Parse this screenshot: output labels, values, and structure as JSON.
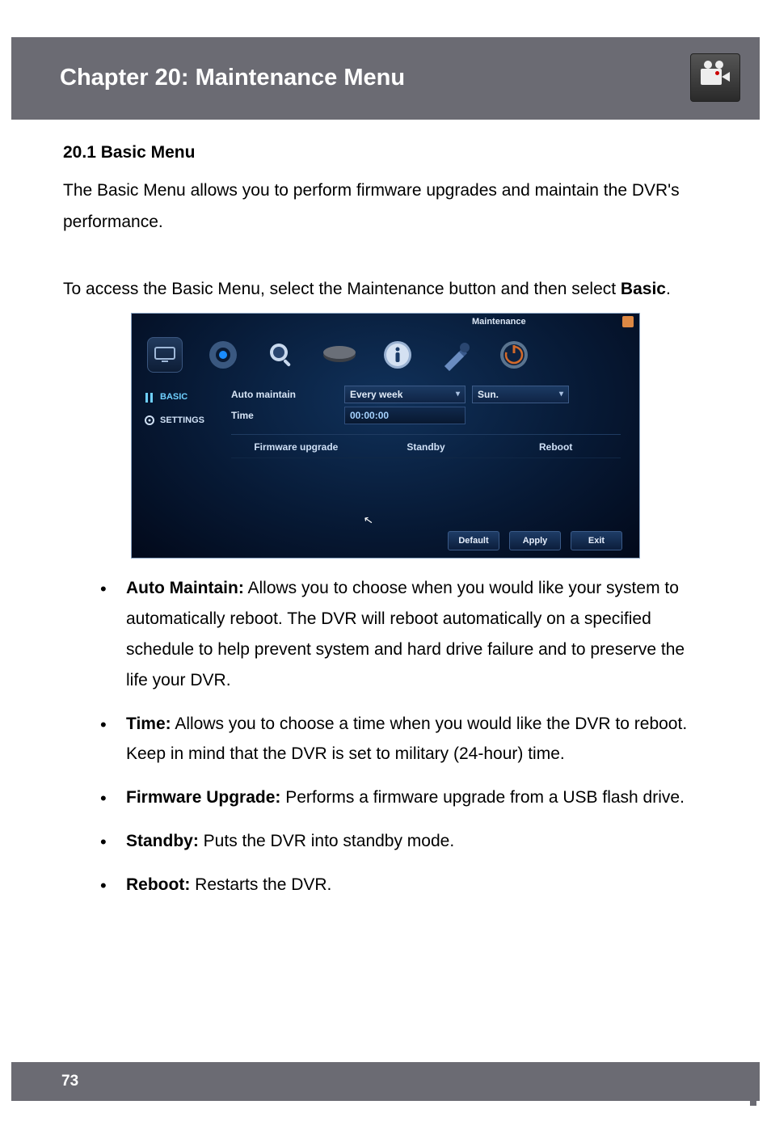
{
  "chapter_title": "Chapter 20: Maintenance Menu",
  "section_heading": "20.1 Basic Menu",
  "intro_p1": "The Basic Menu allows you to perform firmware upgrades and maintain the DVR's performance.",
  "intro_p2a": "To access the Basic Menu, select the Maintenance button and then select ",
  "intro_p2b": "Basic",
  "intro_p2c": ".",
  "page_number": "73",
  "screenshot": {
    "window_title": "Maintenance",
    "sidebar": {
      "items": [
        {
          "label": "BASIC",
          "active": true
        },
        {
          "label": "SETTINGS",
          "active": false
        }
      ]
    },
    "form": {
      "auto_maintain_label": "Auto maintain",
      "auto_maintain_value": "Every week",
      "day_value": "Sun.",
      "time_label": "Time",
      "time_value": "00:00:00"
    },
    "action_buttons": {
      "firmware": "Firmware upgrade",
      "standby": "Standby",
      "reboot": "Reboot"
    },
    "footer_buttons": {
      "default": "Default",
      "apply": "Apply",
      "exit": "Exit"
    }
  },
  "bullets": [
    {
      "term": "Auto Maintain:",
      "text": " Allows you to choose when you would like your system to automatically reboot. The DVR will reboot automatically on a specified schedule to help prevent system and hard drive failure and to preserve the life your DVR."
    },
    {
      "term": "Time:",
      "text": " Allows you to choose a time when you would like the DVR to reboot. Keep in mind that the DVR is set to military (24-hour) time."
    },
    {
      "term": "Firmware Upgrade:",
      "text": " Performs a firmware upgrade from a USB flash drive."
    },
    {
      "term": "Standby:",
      "text": " Puts the DVR into standby mode."
    },
    {
      "term": "Reboot:",
      "text": " Restarts the DVR."
    }
  ]
}
